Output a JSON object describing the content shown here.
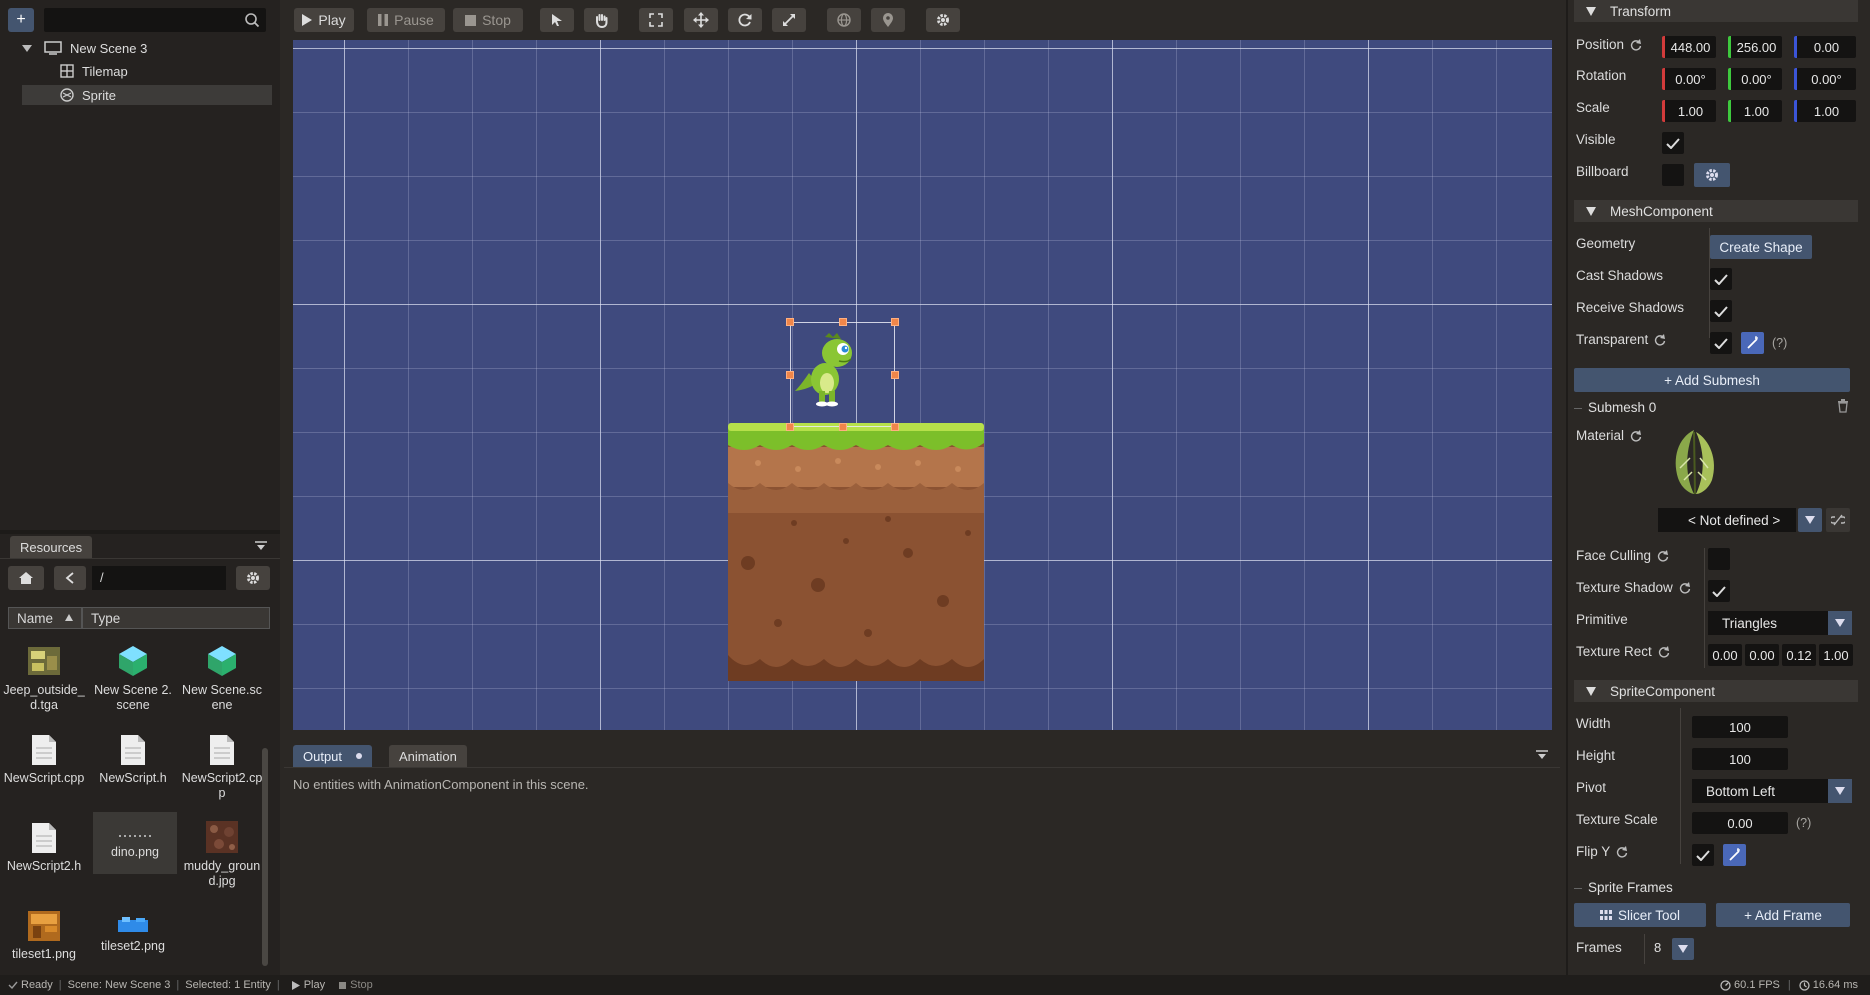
{
  "hierarchy": {
    "add_label": "+",
    "search_value": "",
    "items": [
      {
        "label": "New Scene 3",
        "icon": "monitor-icon"
      },
      {
        "label": "Tilemap",
        "icon": "grid-icon"
      },
      {
        "label": "Sprite",
        "icon": "sprite-icon"
      }
    ]
  },
  "resources": {
    "tab": "Resources",
    "path": "/",
    "col_name": "Name",
    "col_type": "Type",
    "files": [
      {
        "name": "Jeep_outside_d.tga",
        "icon": "texture-icon"
      },
      {
        "name": "New Scene 2.scene",
        "icon": "scene-icon"
      },
      {
        "name": "New Scene.scene",
        "icon": "scene-icon"
      },
      {
        "name": "NewScript.cpp",
        "icon": "file-icon"
      },
      {
        "name": "NewScript.h",
        "icon": "file-icon"
      },
      {
        "name": "NewScript2.cpp",
        "icon": "file-icon"
      },
      {
        "name": "NewScript2.h",
        "icon": "file-icon"
      },
      {
        "name": "dino.png",
        "icon": "image-icon"
      },
      {
        "name": "muddy_ground.jpg",
        "icon": "texture-icon"
      },
      {
        "name": "tileset1.png",
        "icon": "texture-icon"
      },
      {
        "name": "tileset2.png",
        "icon": "texture-icon"
      }
    ]
  },
  "toolbar": {
    "play": "Play",
    "pause": "Pause",
    "stop": "Stop"
  },
  "output": {
    "tab_output": "Output",
    "tab_animation": "Animation",
    "message": "No entities with AnimationComponent in this scene."
  },
  "inspector": {
    "transform": {
      "title": "Transform",
      "position_label": "Position",
      "position": [
        "448.00",
        "256.00",
        "0.00"
      ],
      "rotation_label": "Rotation",
      "rotation": [
        "0.00°",
        "0.00°",
        "0.00°"
      ],
      "scale_label": "Scale",
      "scale": [
        "1.00",
        "1.00",
        "1.00"
      ],
      "visible_label": "Visible",
      "billboard_label": "Billboard"
    },
    "mesh": {
      "title": "MeshComponent",
      "geometry_label": "Geometry",
      "create_shape": "Create Shape",
      "cast_shadows_label": "Cast Shadows",
      "receive_shadows_label": "Receive Shadows",
      "transparent_label": "Transparent",
      "help": "(?)",
      "add_submesh": "+ Add Submesh",
      "submesh_title": "Submesh 0",
      "material_label": "Material",
      "material_value": "< Not defined >",
      "face_culling_label": "Face Culling",
      "texture_shadow_label": "Texture Shadow",
      "primitive_label": "Primitive",
      "primitive_value": "Triangles",
      "texture_rect_label": "Texture Rect",
      "texture_rect": [
        "0.00",
        "0.00",
        "0.12",
        "1.00"
      ]
    },
    "sprite": {
      "title": "SpriteComponent",
      "width_label": "Width",
      "width": "100",
      "height_label": "Height",
      "height": "100",
      "pivot_label": "Pivot",
      "pivot_value": "Bottom Left",
      "texture_scale_label": "Texture Scale",
      "texture_scale": "0.00",
      "help": "(?)",
      "flip_y_label": "Flip Y",
      "frames_title": "Sprite Frames",
      "slicer_tool": "Slicer Tool",
      "add_frame": "+ Add Frame",
      "frames_label": "Frames",
      "frames_value": "8"
    }
  },
  "status": {
    "ready": "Ready",
    "scene": "Scene: New Scene 3",
    "selected": "Selected: 1 Entity",
    "play": "Play",
    "stop": "Stop",
    "fps": "60.1 FPS",
    "ms": "16.64 ms"
  },
  "colors": {
    "accent": "#44556f",
    "viewport": "#3f4a7e",
    "axis_x": "#d23b3b",
    "axis_y": "#3ec93e",
    "axis_z": "#3b55d8"
  }
}
